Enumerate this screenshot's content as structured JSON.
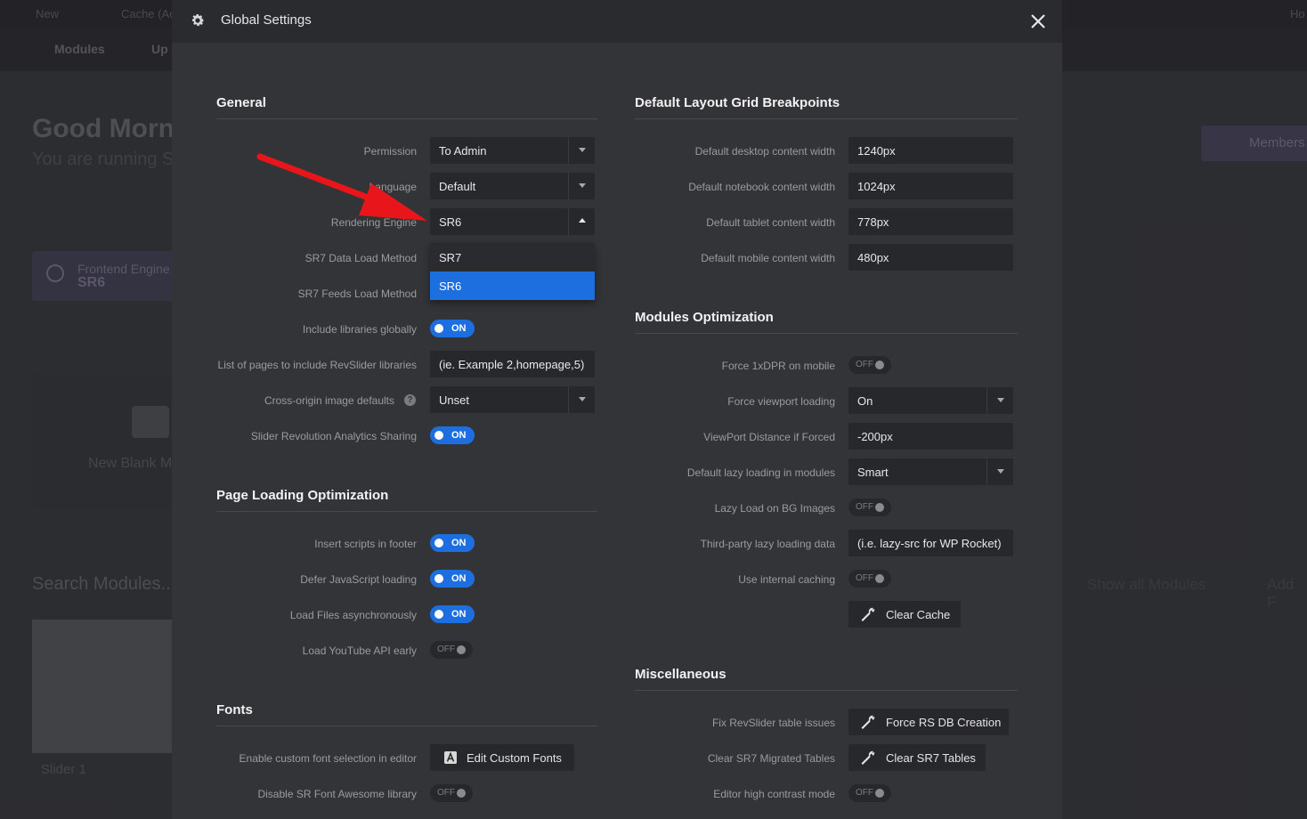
{
  "background": {
    "topbar": {
      "new": "New",
      "cache": "Cache (Ad",
      "right": "Ho"
    },
    "nav": {
      "modules": "Modules",
      "updates": "Up"
    },
    "greeting": "Good Morn",
    "running": "You are running S",
    "engine_card": {
      "label": "Frontend Engine",
      "value": "SR6"
    },
    "new_blank": "New Blank M",
    "search": "Search Modules...",
    "slider_name": "Slider 1",
    "members": "Members",
    "show_all": "Show all Modules",
    "add": "Add F"
  },
  "modal": {
    "title": "Global Settings",
    "general": {
      "heading": "General",
      "permission": {
        "label": "Permission",
        "value": "To Admin"
      },
      "language": {
        "label": "Language",
        "value": "Default"
      },
      "rendering_engine": {
        "label": "Rendering Engine",
        "value": "SR6",
        "options": [
          "SR7",
          "SR6"
        ]
      },
      "sr7_data": {
        "label": "SR7 Data Load Method"
      },
      "sr7_feeds": {
        "label": "SR7 Feeds Load Method"
      },
      "include_libs": {
        "label": "Include libraries globally",
        "state": "ON"
      },
      "pages_list": {
        "label": "List of pages to include RevSlider libraries",
        "value": "(ie. Example 2,homepage,5)"
      },
      "cross_origin": {
        "label": "Cross-origin image defaults",
        "value": "Unset",
        "help": "?"
      },
      "analytics": {
        "label": "Slider Revolution Analytics Sharing",
        "state": "ON"
      }
    },
    "page_loading": {
      "heading": "Page Loading Optimization",
      "footer": {
        "label": "Insert scripts in footer",
        "state": "ON"
      },
      "defer": {
        "label": "Defer JavaScript loading",
        "state": "ON"
      },
      "async": {
        "label": "Load Files asynchronously",
        "state": "ON"
      },
      "youtube": {
        "label": "Load YouTube API early",
        "state": "OFF"
      }
    },
    "fonts": {
      "heading": "Fonts",
      "custom": {
        "label": "Enable custom font selection in editor",
        "button": "Edit Custom Fonts"
      },
      "awesome": {
        "label": "Disable SR Font Awesome library",
        "state": "OFF"
      }
    },
    "grid": {
      "heading": "Default Layout Grid Breakpoints",
      "desktop": {
        "label": "Default desktop content width",
        "value": "1240px"
      },
      "notebook": {
        "label": "Default notebook content width",
        "value": "1024px"
      },
      "tablet": {
        "label": "Default tablet content width",
        "value": "778px"
      },
      "mobile": {
        "label": "Default mobile content width",
        "value": "480px"
      }
    },
    "modules_opt": {
      "heading": "Modules Optimization",
      "dpr": {
        "label": "Force 1xDPR on mobile",
        "state": "OFF"
      },
      "viewport": {
        "label": "Force viewport loading",
        "value": "On"
      },
      "distance": {
        "label": "ViewPort Distance if Forced",
        "value": "-200px"
      },
      "lazy": {
        "label": "Default lazy loading in modules",
        "value": "Smart"
      },
      "bg_lazy": {
        "label": "Lazy Load on BG Images",
        "state": "OFF"
      },
      "third_party": {
        "label": "Third-party lazy loading data",
        "value": "(i.e. lazy-src for WP Rocket)"
      },
      "caching": {
        "label": "Use internal caching",
        "state": "OFF"
      },
      "clear_cache": "Clear Cache"
    },
    "misc": {
      "heading": "Miscellaneous",
      "fix": {
        "label": "Fix RevSlider table issues",
        "button": "Force RS DB Creation"
      },
      "clear_sr7": {
        "label": "Clear SR7 Migrated Tables",
        "button": "Clear SR7 Tables"
      },
      "contrast": {
        "label": "Editor high contrast mode",
        "state": "OFF"
      }
    }
  },
  "colors": {
    "accent": "#1d6fe0",
    "arrow": "#e8161b"
  }
}
